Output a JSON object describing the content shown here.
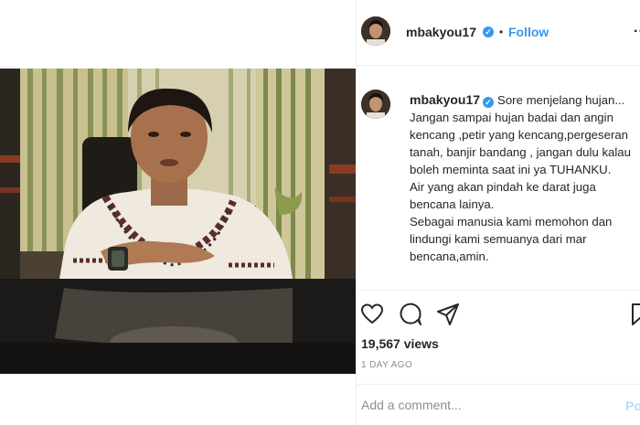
{
  "header": {
    "username": "mbakyou17",
    "dot": "•",
    "follow_label": "Follow",
    "more_label": "..."
  },
  "caption": {
    "username": "mbakyou17",
    "first_line": "Sore menjelang hujan...",
    "lines": [
      "Jangan sampai hujan badai dan angin kencang ,petir yang kencang,pergeseran tanah, banjir bandang , jangan dulu kalau boleh meminta saat ini ya TUHANKU.",
      "Air yang akan pindah ke darat juga bencana lainya.",
      "Sebagai manusia kami memohon dan lindungi kami semuanya dari mar bencana,amin."
    ]
  },
  "stats": {
    "views": "19,567 views",
    "time": "1 DAY AGO"
  },
  "comment": {
    "placeholder": "Add a comment...",
    "post_label": "Post"
  },
  "colors": {
    "accent": "#3897f0",
    "muted": "#8e8e8e",
    "border": "#efefef",
    "post_disabled": "#b2dffc"
  },
  "icons": [
    "verified-badge-icon",
    "heart-icon",
    "comment-icon",
    "share-icon",
    "bookmark-icon"
  ]
}
